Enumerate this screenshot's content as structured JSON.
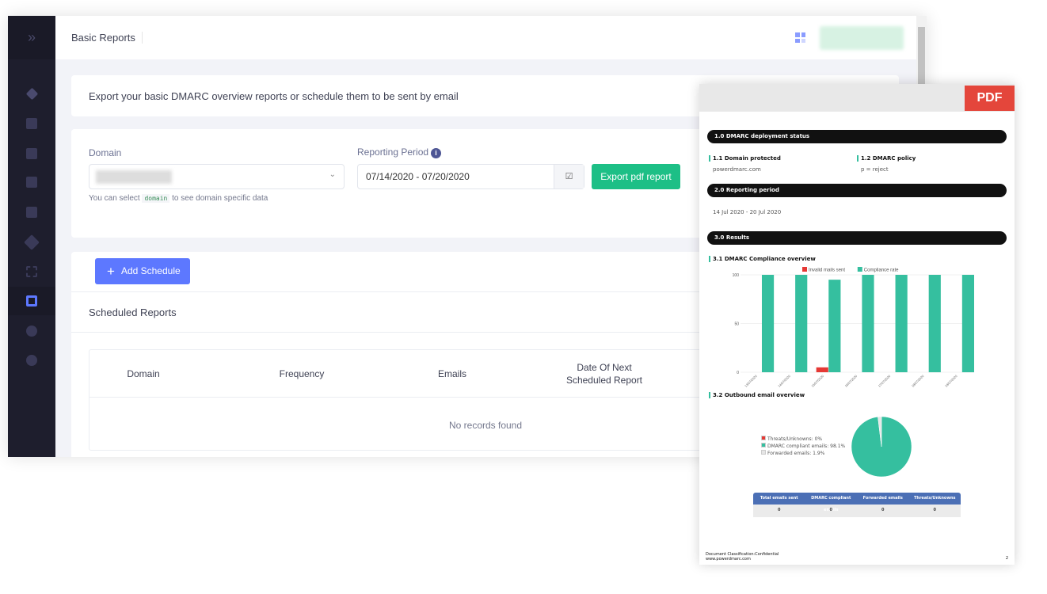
{
  "header": {
    "title": "Basic Reports"
  },
  "intro": "Export your basic DMARC overview reports or schedule them to be sent by email",
  "form": {
    "domain_label": "Domain",
    "domain_hint_pre": "You can select",
    "domain_hint_code": "domain",
    "domain_hint_post": "to see domain specific data",
    "period_label": "Reporting Period",
    "period_value": "07/14/2020 - 07/20/2020",
    "export_label": "Export pdf report"
  },
  "schedule": {
    "add_label": "Add Schedule",
    "title": "Scheduled Reports",
    "columns": [
      "Domain",
      "Frequency",
      "Emails",
      "Date Of Next\nScheduled Report"
    ],
    "empty": "No records found"
  },
  "pdf": {
    "badge": "PDF",
    "s1": "1.0 DMARC deployment status",
    "s11": "1.1 Domain protected",
    "s11v": "powerdmarc.com",
    "s12": "1.2 DMARC policy",
    "s12v": "p = reject",
    "s2": "2.0 Reporting period",
    "s2v": "14 Jul 2020 - 20 Jul 2020",
    "s3": "3.0 Results",
    "s31": "3.1 DMARC Compliance overview",
    "s32": "3.2 Outbound email overview",
    "table_headers": [
      "Total emails sent",
      "DMARC compliant emails",
      "Forwarded emails",
      "Threats/Unknowns"
    ],
    "table_values": [
      "0",
      "0",
      "0",
      "0"
    ],
    "footer1": "Document Classification:Confidential",
    "footer2": "www.powerdmarc.com",
    "page": "2"
  },
  "chart_data": [
    {
      "type": "bar",
      "categories": [
        "13/07/2020",
        "14/07/2020",
        "15/07/2020",
        "16/07/2020",
        "17/07/2020",
        "18/07/2020",
        "19/07/2020"
      ],
      "series": [
        {
          "name": "Invalid mails sent",
          "color": "#e53935",
          "values": [
            0,
            0,
            5,
            0,
            0,
            0,
            0
          ]
        },
        {
          "name": "Compliance rate",
          "color": "#35bf9f",
          "values": [
            100,
            100,
            95,
            100,
            100,
            100,
            100
          ]
        }
      ],
      "yticks": [
        0,
        50,
        100
      ],
      "ylim": [
        0,
        100
      ],
      "legend": "top"
    },
    {
      "type": "pie",
      "slices": [
        {
          "label": "Threats/Unknowns: 0%",
          "value": 0,
          "color": "#e53935"
        },
        {
          "label": "DMARC compliant emails: 98.1%",
          "value": 98.1,
          "color": "#35bf9f"
        },
        {
          "label": "Forwarded emails: 1.9%",
          "value": 1.9,
          "color": "#e6e6e6"
        }
      ],
      "legend": "left"
    }
  ]
}
